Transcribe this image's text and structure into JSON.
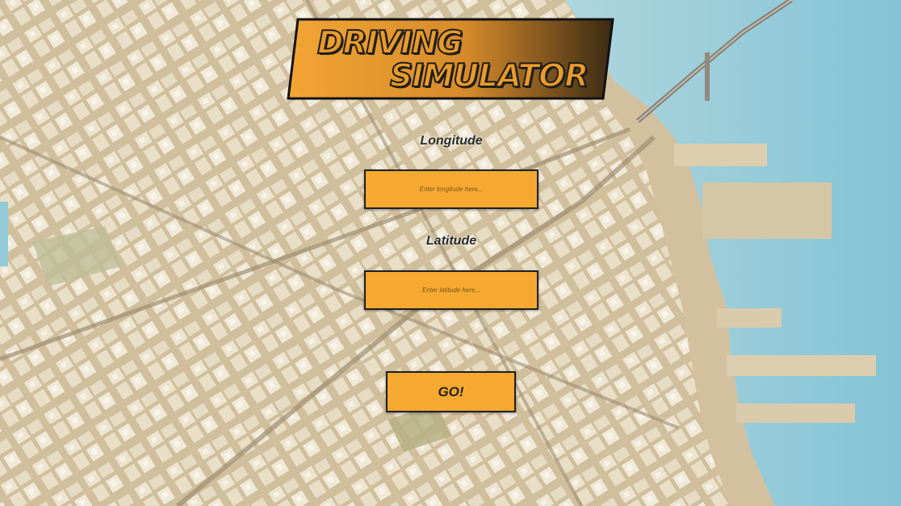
{
  "title": {
    "line1": "DRIVING",
    "line2": "SIMULATOR"
  },
  "longitude": {
    "label": "Longitude",
    "placeholder": "Enter longitude here...",
    "value": ""
  },
  "latitude": {
    "label": "Latitude",
    "placeholder": "Enter latitude here...",
    "value": ""
  },
  "go_button": {
    "label": "GO!"
  },
  "colors": {
    "accent_orange": "#f6a930",
    "banner_gradient_start": "#f3a533",
    "banner_gradient_end": "#3a2a14",
    "border": "#1f1f1f",
    "water": "#7fc4d8",
    "ground": "#d9c7a4"
  }
}
